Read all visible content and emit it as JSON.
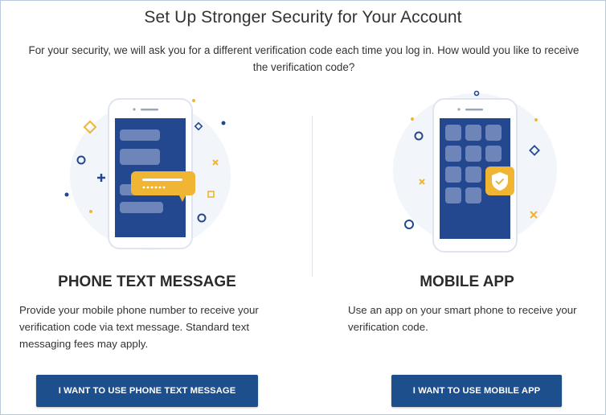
{
  "page": {
    "title": "Set Up Stronger Security for Your Account",
    "intro": "For your security, we will ask you for a different verification code each time you log in. How would you like to receive the verification code?"
  },
  "options": {
    "sms": {
      "title": "PHONE TEXT MESSAGE",
      "description": "Provide your mobile phone number to receive your verification code via text message. Standard text messaging fees may apply.",
      "button_label": "I WANT TO USE PHONE TEXT MESSAGE",
      "illustration_icon": "phone-sms-illustration"
    },
    "app": {
      "title": "MOBILE APP",
      "description": "Use an app on your smart phone to receive your verification code.",
      "button_label": "I WANT TO USE MOBILE APP",
      "illustration_icon": "phone-app-shield-illustration"
    }
  },
  "colors": {
    "primary_button": "#1d4f8c",
    "phone_screen": "#23488f",
    "accent_yellow": "#f1b534",
    "border": "#b9c9dc"
  }
}
